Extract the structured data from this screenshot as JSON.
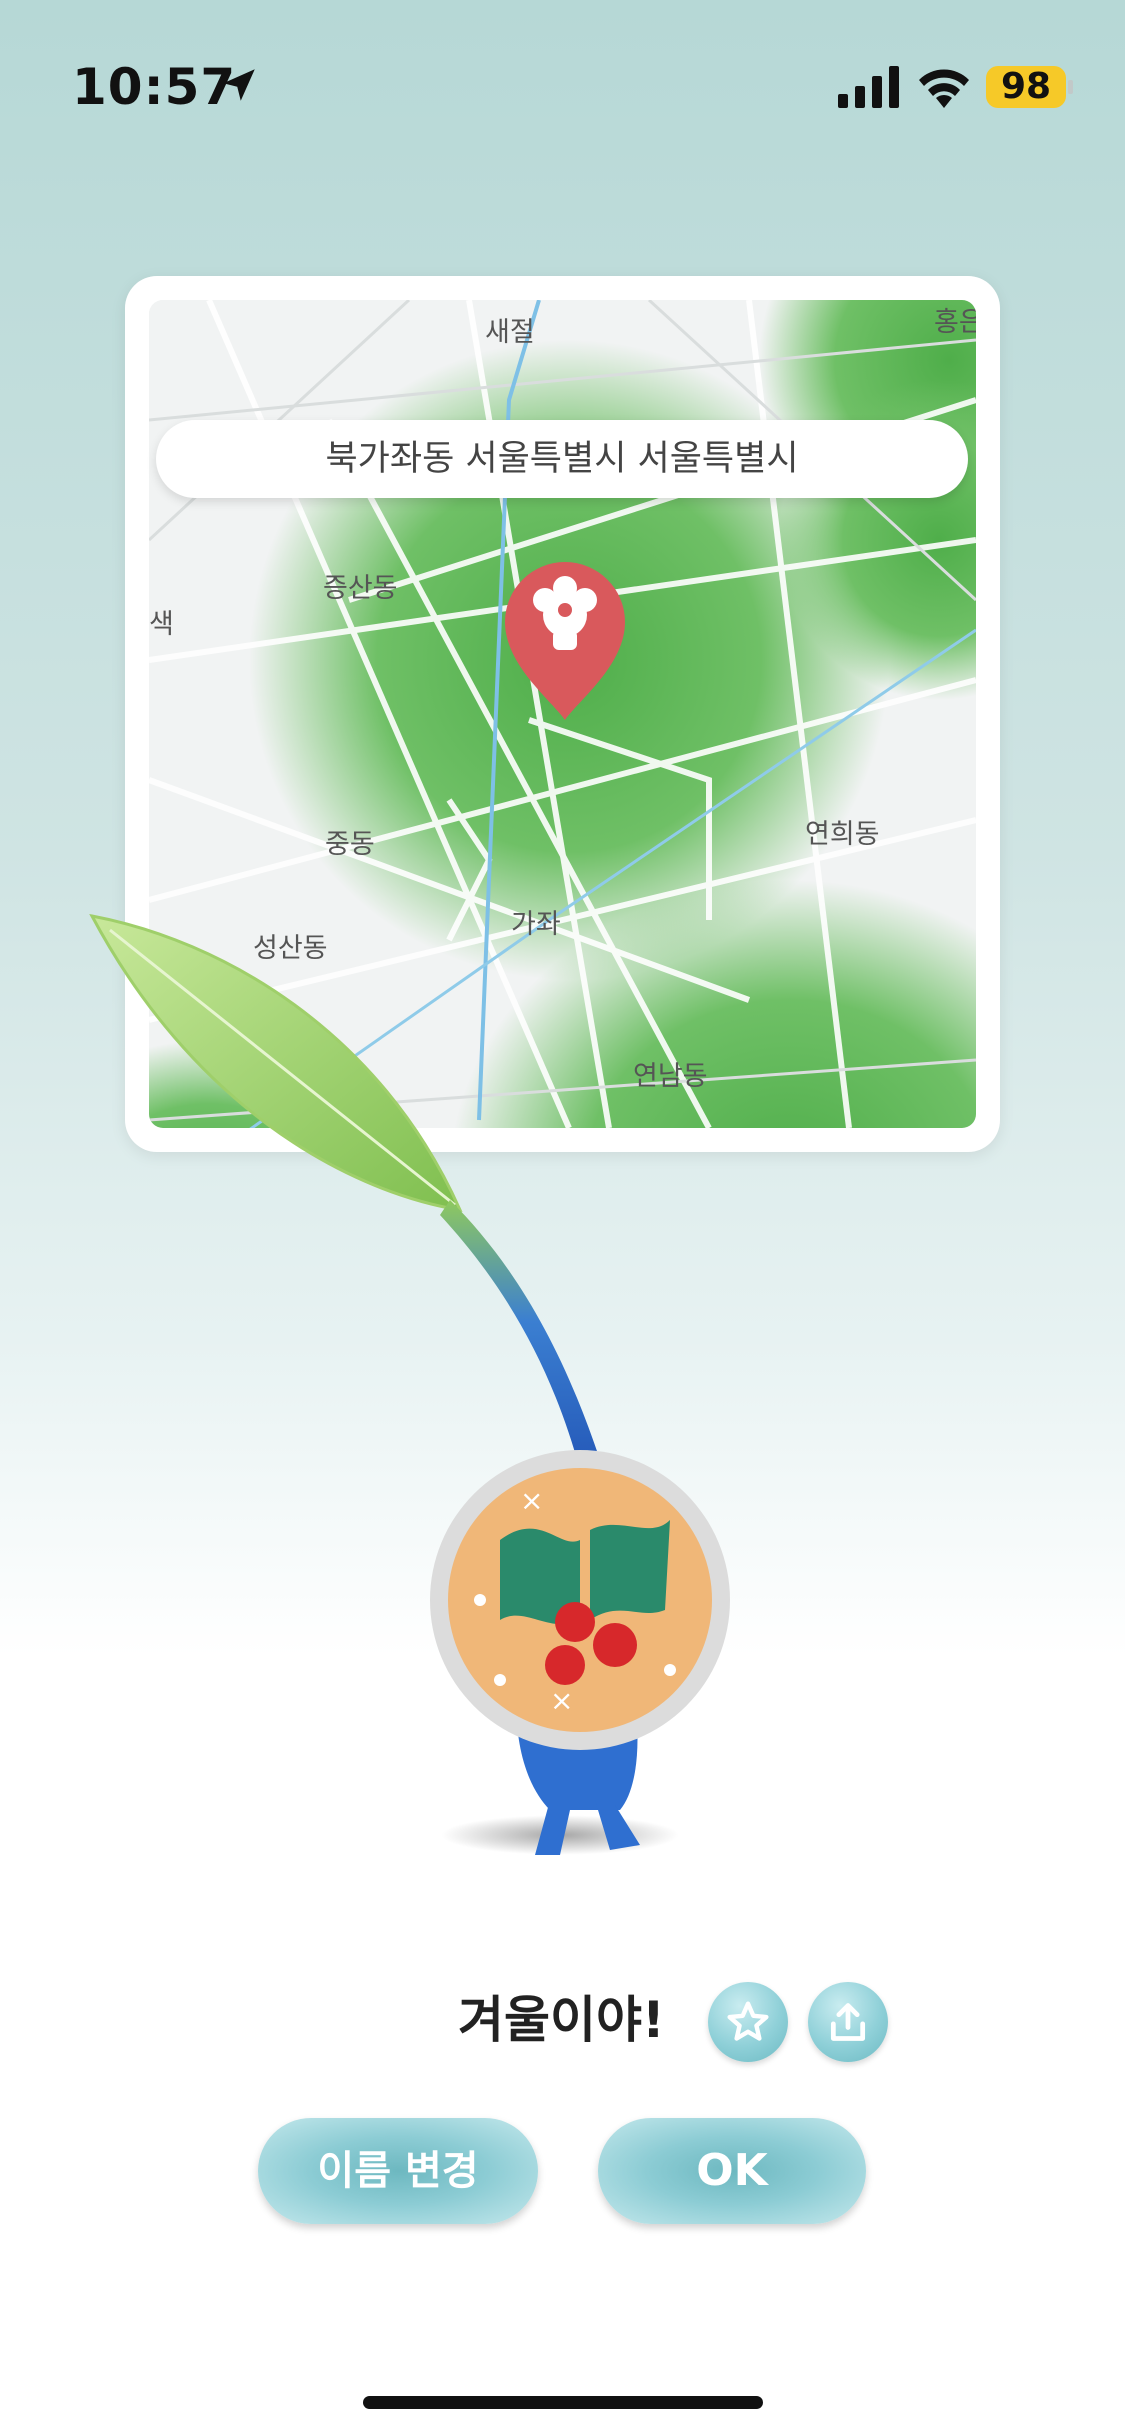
{
  "status_bar": {
    "time": "10:57",
    "battery": "98"
  },
  "map": {
    "address": "북가좌동 서울특별시 서울특별시",
    "labels": [
      "새절",
      "홍은",
      "증산동",
      "색",
      "중동",
      "연희동",
      "가좌",
      "성산동",
      "연남동"
    ],
    "pin_color": "#d9595c"
  },
  "pikmin": {
    "name": "겨울이야!"
  },
  "buttons": {
    "rename": "이름 변경",
    "ok": "OK"
  },
  "icons": {
    "favorite": "star-icon",
    "share": "share-icon"
  }
}
